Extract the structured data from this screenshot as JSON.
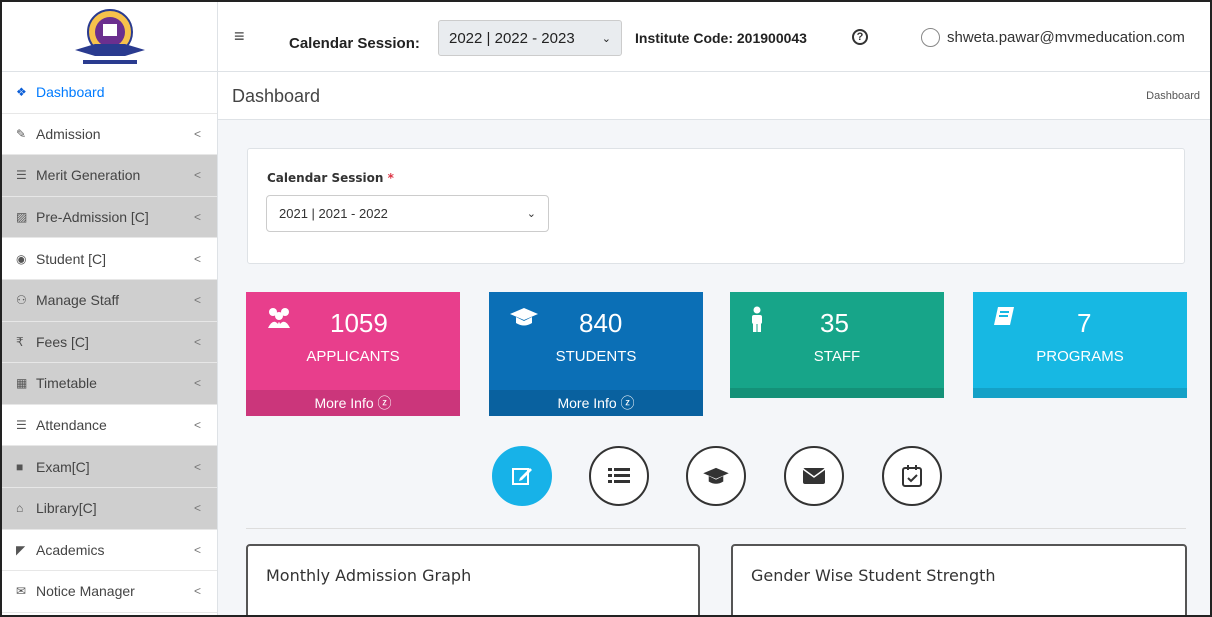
{
  "header": {
    "calendar_label": "Calendar Session:",
    "session_value": "2022 | 2022 - 2023",
    "institute_code": "Institute Code: 201900043",
    "help_glyph": "?",
    "user_email": "shweta.pawar@mvmeducation.com"
  },
  "sidebar": {
    "items": [
      {
        "label": "Dashboard",
        "icon": "❖"
      },
      {
        "label": "Admission",
        "icon": "✎"
      },
      {
        "label": "Merit Generation",
        "icon": "☰"
      },
      {
        "label": "Pre-Admission [C]",
        "icon": "▨"
      },
      {
        "label": "Student [C]",
        "icon": "◉"
      },
      {
        "label": "Manage Staff",
        "icon": "⚇"
      },
      {
        "label": "Fees [C]",
        "icon": "₹"
      },
      {
        "label": "Timetable",
        "icon": "▦"
      },
      {
        "label": "Attendance",
        "icon": "☰"
      },
      {
        "label": "Exam[C]",
        "icon": "■"
      },
      {
        "label": "Library[C]",
        "icon": "⌂"
      },
      {
        "label": "Academics",
        "icon": "◤"
      },
      {
        "label": "Notice Manager",
        "icon": "✉"
      }
    ],
    "chevron": "<"
  },
  "content": {
    "title": "Dashboard",
    "breadcrumb": "Dashboard"
  },
  "session_card": {
    "label": "Calendar Session",
    "required": "*",
    "value": "2021 | 2021 - 2022"
  },
  "stats": {
    "applicants": {
      "value": "1059",
      "label": "APPLICANTS",
      "more": "More Info ⓩ"
    },
    "students": {
      "value": "840",
      "label": "STUDENTS",
      "more": "More Info ⓩ"
    },
    "staff": {
      "value": "35",
      "label": "STAFF"
    },
    "programs": {
      "value": "7",
      "label": "PROGRAMS"
    }
  },
  "graphs": {
    "monthly": "Monthly Admission Graph",
    "gender": "Gender Wise Student Strength"
  },
  "colors": {
    "pink": "#e83e8c",
    "blue": "#0b6fb6",
    "teal": "#17a589",
    "cyan": "#17b8e3"
  }
}
